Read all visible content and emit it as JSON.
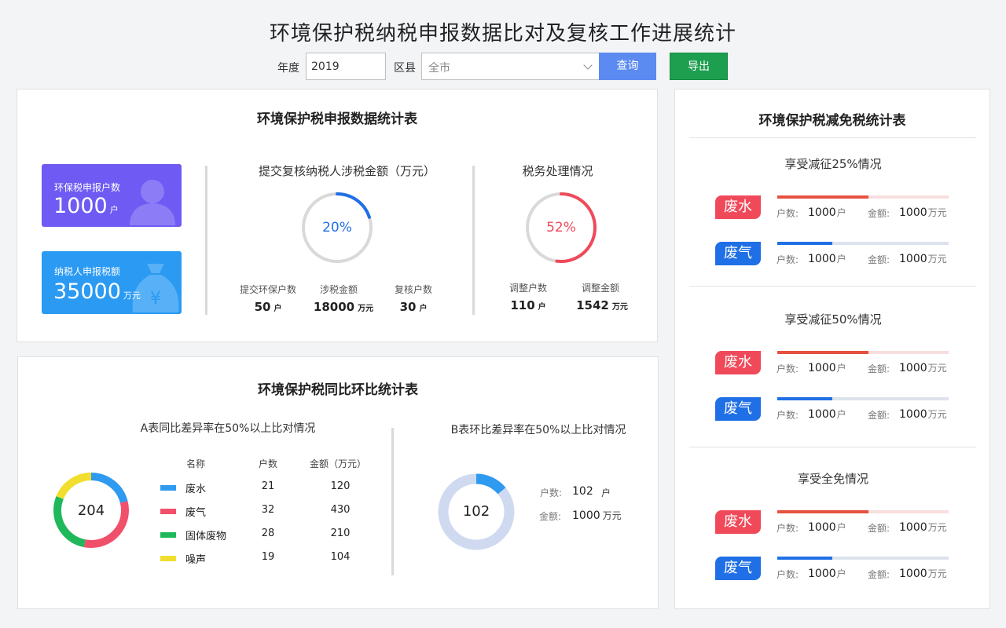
{
  "page_title": "环境保护税纳税申报数据比对及复核工作进展统计",
  "toolbar": {
    "year_label": "年度",
    "year_value": "2019",
    "district_label": "区县",
    "district_value": "全市",
    "query_label": "查询",
    "export_label": "导出"
  },
  "colors": {
    "blue": "#5b8bf0",
    "green": "#1e9e4f",
    "red": "#f04a5a",
    "deep_blue": "#1f6fe6"
  },
  "stats_card": {
    "title": "环境保护税申报数据统计表",
    "kpi1": {
      "label": "环保税申报户数",
      "value": "1000",
      "unit": "户",
      "icon": "user-icon"
    },
    "kpi2": {
      "label": "纳税人申报税额",
      "value": "35000",
      "unit": "万元",
      "icon": "money-bag-icon"
    },
    "review": {
      "title": "提交复核纳税人涉税金额（万元）",
      "percent": 20,
      "percent_label": "20%",
      "items": [
        {
          "label": "提交环保户数",
          "value": "50",
          "unit": "户"
        },
        {
          "label": "涉税金额",
          "value": "18000",
          "unit": "万元"
        },
        {
          "label": "复核户数",
          "value": "30",
          "unit": "户"
        }
      ]
    },
    "handling": {
      "title": "税务处理情况",
      "percent": 52,
      "percent_label": "52%",
      "items": [
        {
          "label": "调整户数",
          "value": "110",
          "unit": "户"
        },
        {
          "label": "调整金额",
          "value": "1542",
          "unit": "万元"
        }
      ]
    }
  },
  "compare_card": {
    "title": "环境保护税同比环比统计表",
    "a": {
      "title": "A表同比差异率在50%以上比对情况",
      "total": "204",
      "headers": [
        "名称",
        "户数",
        "金额（万元）"
      ],
      "rows": [
        {
          "name": "废水",
          "count": "21",
          "amount": "120",
          "color": "#2e9af0"
        },
        {
          "name": "废气",
          "count": "32",
          "amount": "430",
          "color": "#f0506a"
        },
        {
          "name": "固体废物",
          "count": "28",
          "amount": "210",
          "color": "#1fb85a"
        },
        {
          "name": "噪声",
          "count": "19",
          "amount": "104",
          "color": "#f2de2e"
        }
      ]
    },
    "b": {
      "title": "B表环比差异率在50%以上比对情况",
      "total": "102",
      "count_label": "户数:",
      "count_value": "102",
      "count_unit": "户",
      "amount_label": "金额:",
      "amount_value": "1000",
      "amount_unit": "万元",
      "fraction": 0.14
    }
  },
  "relief_card": {
    "title": "环境保护税减免税统计表",
    "sections": [
      {
        "title": "享受减征25%情况",
        "rows": [
          {
            "badge": "废水",
            "kind": "red",
            "fill": 0.53,
            "count_label": "户数:",
            "count": "1000",
            "count_unit": "户",
            "amount_label": "金额:",
            "amount": "1000",
            "amount_unit": "万元"
          },
          {
            "badge": "废气",
            "kind": "blue",
            "fill": 0.32,
            "count_label": "户数:",
            "count": "1000",
            "count_unit": "户",
            "amount_label": "金额:",
            "amount": "1000",
            "amount_unit": "万元"
          }
        ]
      },
      {
        "title": "享受减征50%情况",
        "rows": [
          {
            "badge": "废水",
            "kind": "red",
            "fill": 0.53,
            "count_label": "户数:",
            "count": "1000",
            "count_unit": "户",
            "amount_label": "金额:",
            "amount": "1000",
            "amount_unit": "万元"
          },
          {
            "badge": "废气",
            "kind": "blue",
            "fill": 0.32,
            "count_label": "户数:",
            "count": "1000",
            "count_unit": "户",
            "amount_label": "金额:",
            "amount": "1000",
            "amount_unit": "万元"
          }
        ]
      },
      {
        "title": "享受全免情况",
        "rows": [
          {
            "badge": "废水",
            "kind": "red",
            "fill": 0.53,
            "count_label": "户数:",
            "count": "1000",
            "count_unit": "户",
            "amount_label": "金额:",
            "amount": "1000",
            "amount_unit": "万元"
          },
          {
            "badge": "废气",
            "kind": "blue",
            "fill": 0.32,
            "count_label": "户数:",
            "count": "1000",
            "count_unit": "户",
            "amount_label": "金额:",
            "amount": "1000",
            "amount_unit": "万元"
          }
        ]
      }
    ]
  }
}
